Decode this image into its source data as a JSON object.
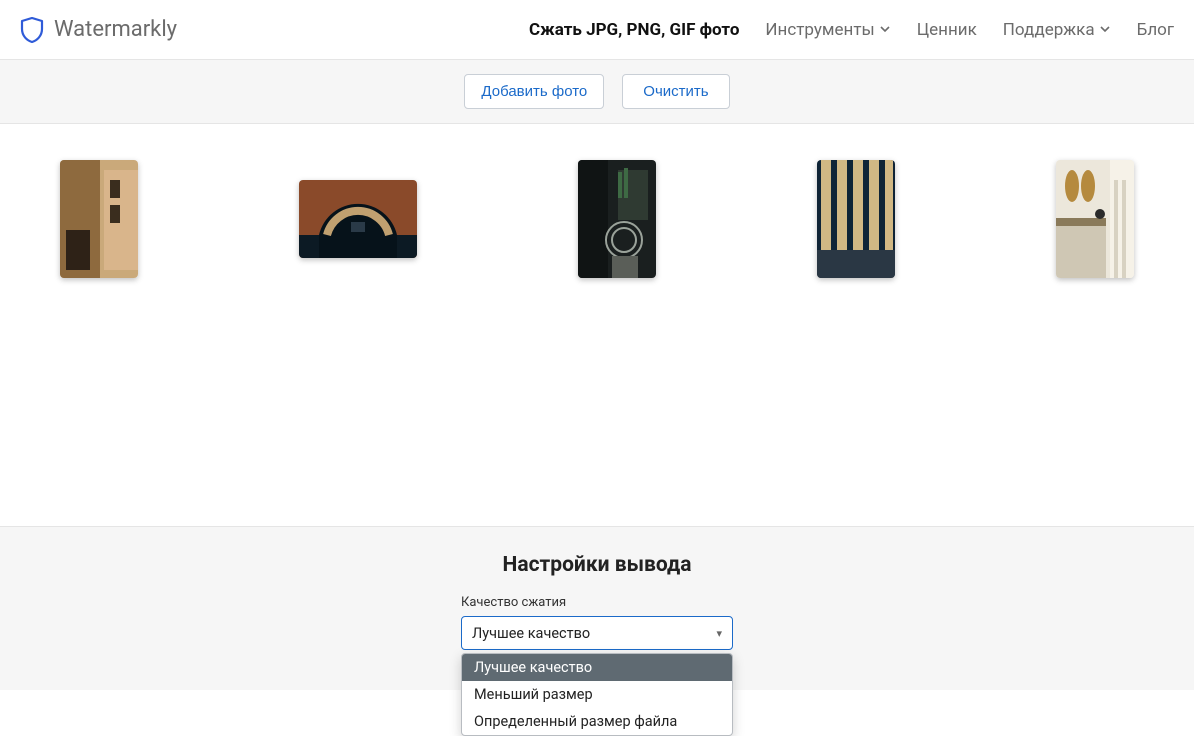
{
  "header": {
    "brand": "Watermarkly",
    "nav": {
      "compress": "Сжать JPG, PNG, GIF фото",
      "tools": "Инструменты",
      "pricing": "Ценник",
      "support": "Поддержка",
      "blog": "Блог"
    }
  },
  "actions": {
    "add_photo": "Добавить фото",
    "clear": "Очистить"
  },
  "settings": {
    "title": "Настройки вывода",
    "quality_label": "Качество сжатия",
    "selected": "Лучшее качество",
    "options": {
      "best": "Лучшее качество",
      "smaller": "Меньший размер",
      "target_size": "Определенный размер файла"
    }
  }
}
